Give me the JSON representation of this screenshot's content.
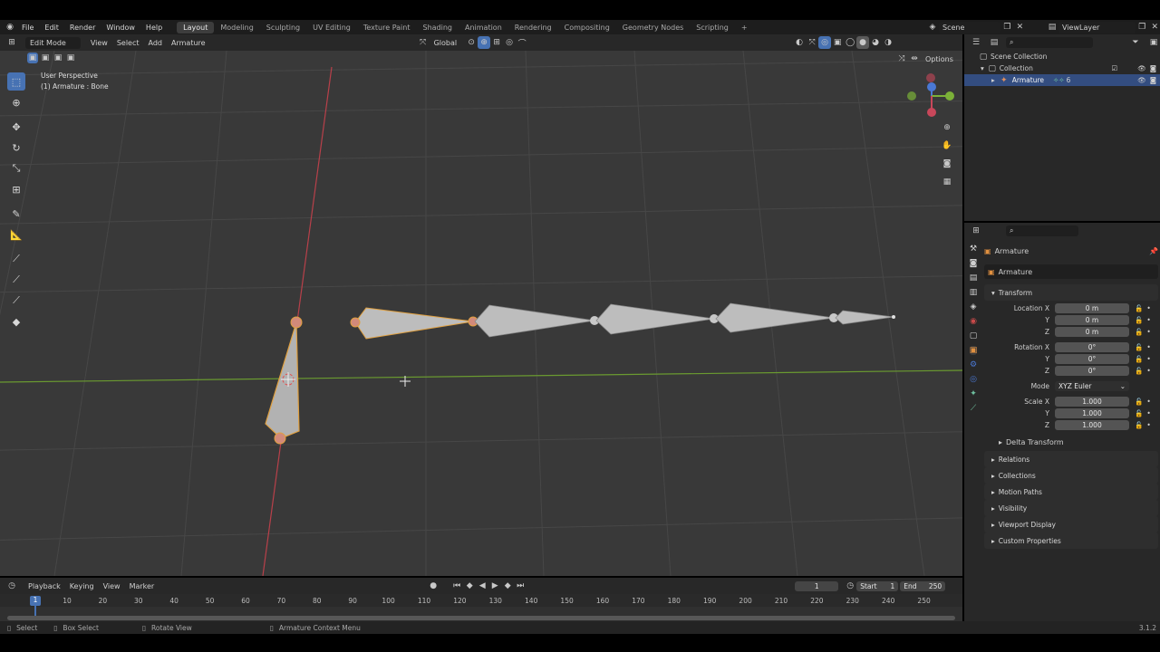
{
  "topbar": {
    "menus": [
      "File",
      "Edit",
      "Render",
      "Window",
      "Help"
    ],
    "workspaces": [
      "Layout",
      "Modeling",
      "Sculpting",
      "UV Editing",
      "Texture Paint",
      "Shading",
      "Animation",
      "Rendering",
      "Compositing",
      "Geometry Nodes",
      "Scripting"
    ],
    "add_tab": "+",
    "scene": "Scene",
    "view_layer": "ViewLayer"
  },
  "viewport_header": {
    "mode": "Edit Mode",
    "menus": [
      "View",
      "Select",
      "Add",
      "Armature"
    ],
    "orientation": "Global",
    "options": "Options"
  },
  "viewport": {
    "perspective": "User Perspective",
    "object_label": "(1) Armature : Bone",
    "colors": {
      "background": "#393939",
      "grid": "#474747",
      "x_axis": "#b8404a",
      "y_axis": "#6a9a30",
      "bone": "#a9a9a9",
      "selected": "#e0a040"
    }
  },
  "outliner": {
    "items": [
      "Scene Collection",
      "Collection",
      "Armature"
    ],
    "armature_count": "6"
  },
  "properties": {
    "object_name": "Armature",
    "data_name": "Armature",
    "transform_label": "Transform",
    "location": {
      "label": "Location X",
      "x": "0 m",
      "y": "0 m",
      "z": "0 m"
    },
    "rotation": {
      "label": "Rotation X",
      "x": "0°",
      "y": "0°",
      "z": "0°"
    },
    "mode_label": "Mode",
    "mode_value": "XYZ Euler",
    "scale": {
      "label": "Scale X",
      "x": "1.000",
      "y": "1.000",
      "z": "1.000"
    },
    "y_label": "Y",
    "z_label": "Z",
    "delta_transform": "Delta Transform",
    "panels": [
      "Relations",
      "Collections",
      "Motion Paths",
      "Visibility",
      "Viewport Display",
      "Custom Properties"
    ]
  },
  "timeline": {
    "menus": [
      "Playback",
      "Keying",
      "View",
      "Marker"
    ],
    "current_frame": "1",
    "start_label": "Start",
    "start": "1",
    "end_label": "End",
    "end": "250",
    "ticks": [
      "10",
      "20",
      "30",
      "40",
      "50",
      "60",
      "70",
      "80",
      "90",
      "100",
      "110",
      "120",
      "130",
      "140",
      "150",
      "160",
      "170",
      "180",
      "190",
      "200",
      "210",
      "220",
      "230",
      "240",
      "250"
    ],
    "playhead_label": "1"
  },
  "statusbar": {
    "select": "Select",
    "box_select": "Box Select",
    "rotate_view": "Rotate View",
    "context_menu": "Armature Context Menu",
    "version": "3.1.2"
  }
}
